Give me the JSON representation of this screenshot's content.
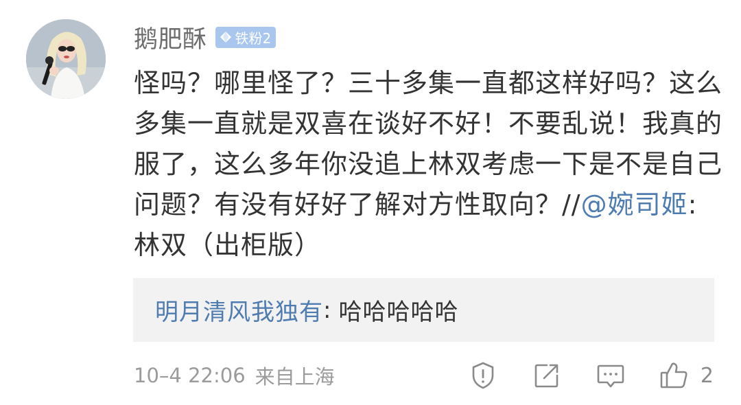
{
  "comment": {
    "author": {
      "name": "鹅肥酥",
      "badge_label": "铁粉2",
      "badge_color": "#a8c6ee"
    },
    "text_before_mention": "怪吗？哪里怪了？三十多集一直都这样好吗？这么多集一直就是双喜在谈好不好！不要乱说！我真的服了，这么多年你没追上林双考虑一下是不是自己问题？有没有好好了解对方性取向？//",
    "mention": "@婉司姬",
    "text_after_mention": ":林双（出柜版）",
    "reply": {
      "user": "明月清风我独有",
      "separator": ":",
      "text": "哈哈哈哈哈"
    },
    "meta": {
      "time": "10–4 22:06",
      "source": "来自上海"
    },
    "actions": {
      "like_count": "2"
    }
  },
  "colors": {
    "link": "#4f7cb0",
    "body_text": "#333333",
    "meta_text": "#9b9b9b",
    "reply_bg": "#f2f2f2"
  },
  "icons": [
    "report-icon",
    "repost-icon",
    "comment-icon",
    "like-icon"
  ]
}
